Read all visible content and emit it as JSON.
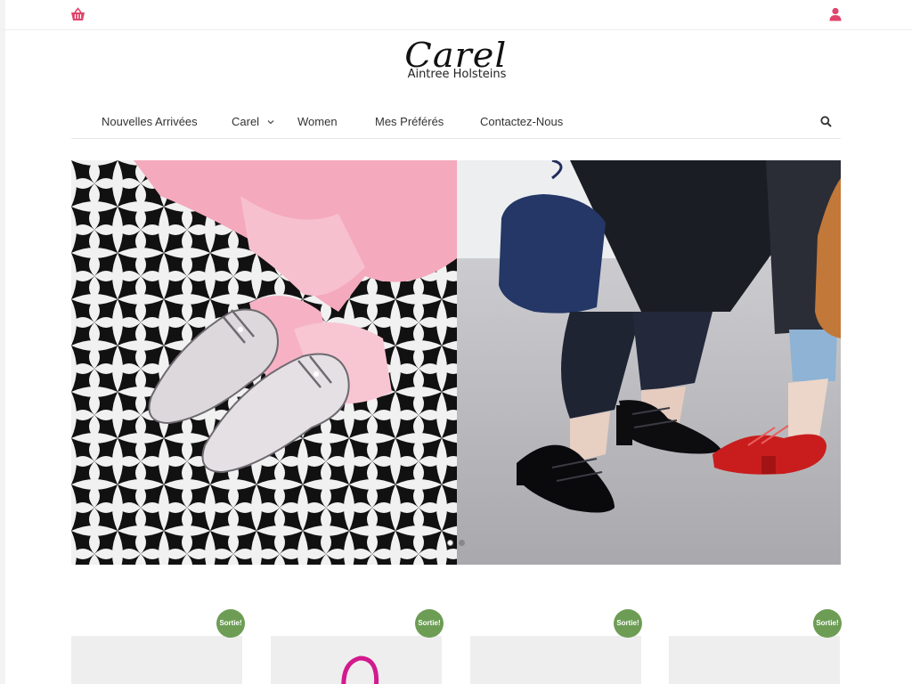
{
  "header": {
    "cart_icon": "basket-icon",
    "user_icon": "user-icon",
    "accent_color": "#e0446b"
  },
  "logo": {
    "script": "Carel",
    "subtitle": "Aintree Holsteins"
  },
  "nav": {
    "items": [
      {
        "label": "Nouvelles Arrivées"
      },
      {
        "label": "Carel",
        "has_dropdown": true
      },
      {
        "label": "Women"
      },
      {
        "label": "Mes Préférés"
      },
      {
        "label": "Contactez-Nous"
      }
    ],
    "search_icon": "search-icon"
  },
  "hero": {
    "slides": 2,
    "active_slide": 2
  },
  "products": {
    "badge_color": "#6d9d55",
    "cards": [
      {
        "badge": "Sortie!"
      },
      {
        "badge": "Sortie!"
      },
      {
        "badge": "Sortie!"
      },
      {
        "badge": "Sortie!"
      }
    ]
  }
}
